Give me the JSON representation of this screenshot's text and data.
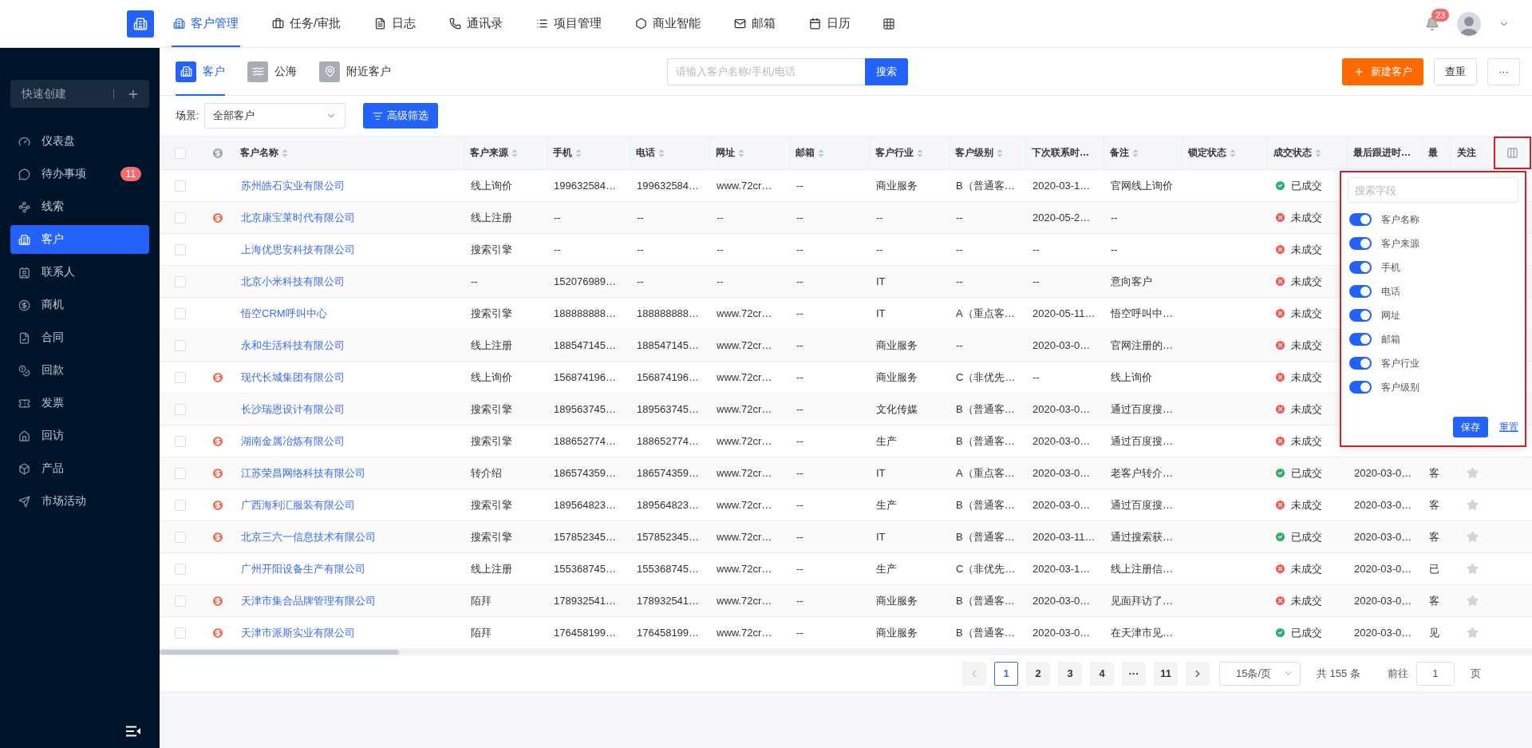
{
  "topbar": {
    "nav": [
      {
        "label": "客户管理",
        "selected": true
      },
      {
        "label": "任务/审批",
        "selected": false
      },
      {
        "label": "日志",
        "selected": false
      },
      {
        "label": "通讯录",
        "selected": false
      },
      {
        "label": "项目管理",
        "selected": false
      },
      {
        "label": "商业智能",
        "selected": false
      },
      {
        "label": "邮箱",
        "selected": false
      },
      {
        "label": "日历",
        "selected": false
      }
    ],
    "notifications": "23"
  },
  "sidebar": {
    "quick_create": "快速创建",
    "items": [
      {
        "label": "仪表盘",
        "selected": false
      },
      {
        "label": "待办事项",
        "selected": false,
        "badge": "11"
      },
      {
        "label": "线索",
        "selected": false
      },
      {
        "label": "客户",
        "selected": true
      },
      {
        "label": "联系人",
        "selected": false
      },
      {
        "label": "商机",
        "selected": false
      },
      {
        "label": "合同",
        "selected": false
      },
      {
        "label": "回款",
        "selected": false
      },
      {
        "label": "发票",
        "selected": false
      },
      {
        "label": "回访",
        "selected": false
      },
      {
        "label": "产品",
        "selected": false
      },
      {
        "label": "市场活动",
        "selected": false
      }
    ]
  },
  "subtabs": [
    {
      "label": "客户",
      "selected": true
    },
    {
      "label": "公海",
      "selected": false
    },
    {
      "label": "附近客户",
      "selected": false
    }
  ],
  "search": {
    "placeholder": "请输入客户名称/手机/电话",
    "button": "搜索"
  },
  "actions": {
    "create": "新建客户",
    "dedupe": "查重",
    "more": "···"
  },
  "filter": {
    "label": "场景:",
    "scene": "全部客户",
    "advanced": "高级筛选"
  },
  "table": {
    "header_checked": false,
    "columns": [
      {
        "label": "客户名称",
        "sortable": true
      },
      {
        "label": "客户来源",
        "sortable": true
      },
      {
        "label": "手机",
        "sortable": true
      },
      {
        "label": "电话",
        "sortable": true
      },
      {
        "label": "网址",
        "sortable": true
      },
      {
        "label": "邮箱",
        "sortable": true
      },
      {
        "label": "客户行业",
        "sortable": true
      },
      {
        "label": "客户级别",
        "sortable": true
      },
      {
        "label": "下次联系时…",
        "sortable": false
      },
      {
        "label": "备注",
        "sortable": true
      },
      {
        "label": "锁定状态",
        "sortable": true
      },
      {
        "label": "成交状态",
        "sortable": true
      },
      {
        "label": "最后跟进时…",
        "sortable": false
      },
      {
        "label": "最",
        "sortable": false
      },
      {
        "label": "关注",
        "sortable": false
      }
    ],
    "rows": [
      {
        "checked": false,
        "deal_icon": false,
        "name": "苏州皓石实业有限公司",
        "source": "线上询价",
        "mobile": "199632584…",
        "phone": "199632584…",
        "website": "www.72cr…",
        "email": "--",
        "industry": "商业服务",
        "level": "B（普通客…",
        "next_contact": "2020-03-1…",
        "note": "官网线上询价",
        "deal_status": "已成交",
        "closed": true
      },
      {
        "checked": false,
        "deal_icon": true,
        "name": "北京康宝莱时代有限公司",
        "source": "线上注册",
        "mobile": "--",
        "phone": "--",
        "website": "--",
        "email": "--",
        "industry": "--",
        "level": "--",
        "next_contact": "2020-05-2…",
        "note": "--",
        "deal_status": "未成交",
        "closed": false
      },
      {
        "checked": false,
        "deal_icon": false,
        "name": "上海优思安科技有限公司",
        "source": "搜索引擎",
        "mobile": "--",
        "phone": "--",
        "website": "--",
        "email": "--",
        "industry": "--",
        "level": "--",
        "next_contact": "--",
        "note": "--",
        "deal_status": "未成交",
        "closed": false
      },
      {
        "checked": false,
        "deal_icon": false,
        "name": "北京小米科技有限公司",
        "source": "--",
        "mobile": "152076989…",
        "phone": "--",
        "website": "--",
        "email": "--",
        "industry": "IT",
        "level": "--",
        "next_contact": "--",
        "note": "意向客户",
        "deal_status": "未成交",
        "closed": false
      },
      {
        "checked": false,
        "deal_icon": false,
        "name": "悟空CRM呼叫中心",
        "source": "搜索引擎",
        "mobile": "188888888…",
        "phone": "188888888…",
        "website": "www.72cr…",
        "email": "--",
        "industry": "IT",
        "level": "A（重点客…",
        "next_contact": "2020-05-11…",
        "note": "悟空呼叫中…",
        "deal_status": "未成交",
        "closed": false
      },
      {
        "checked": false,
        "deal_icon": false,
        "name": "永和生活科技有限公司",
        "source": "线上注册",
        "mobile": "188547145…",
        "phone": "188547145…",
        "website": "www.72cr…",
        "email": "--",
        "industry": "商业服务",
        "level": "--",
        "next_contact": "2020-03-0…",
        "note": "官网注册的…",
        "deal_status": "未成交",
        "closed": false
      },
      {
        "checked": false,
        "deal_icon": true,
        "name": "现代长城集团有限公司",
        "source": "线上询价",
        "mobile": "156874196…",
        "phone": "156874196…",
        "website": "www.72cr…",
        "email": "--",
        "industry": "商业服务",
        "level": "C（非优先…",
        "next_contact": "--",
        "note": "线上询价",
        "deal_status": "未成交",
        "closed": false
      },
      {
        "checked": false,
        "deal_icon": false,
        "name": "长沙瑞恩设计有限公司",
        "source": "搜索引擎",
        "mobile": "189563745…",
        "phone": "189563745…",
        "website": "www.72cr…",
        "email": "--",
        "industry": "文化传媒",
        "level": "B（普通客…",
        "next_contact": "2020-03-0…",
        "note": "通过百度搜…",
        "deal_status": "未成交",
        "closed": false
      },
      {
        "checked": false,
        "deal_icon": true,
        "name": "湖南金属冶炼有限公司",
        "source": "搜索引擎",
        "mobile": "188652774…",
        "phone": "188652774…",
        "website": "www.72cr…",
        "email": "--",
        "industry": "生产",
        "level": "B（普通客…",
        "next_contact": "2020-03-0…",
        "note": "通过百度搜…",
        "deal_status": "未成交",
        "closed": false
      },
      {
        "checked": false,
        "deal_icon": true,
        "name": "江苏荣昌网络科技有限公司",
        "source": "转介绍",
        "mobile": "186574359…",
        "phone": "186574359…",
        "website": "www.72cr…",
        "email": "--",
        "industry": "IT",
        "level": "A（重点客…",
        "next_contact": "2020-03-0…",
        "note": "老客户转介…",
        "deal_status": "已成交",
        "closed": true,
        "last_follow": "2020-03-0…",
        "last": "客",
        "followed": false
      },
      {
        "checked": false,
        "deal_icon": true,
        "name": "广西海利汇服装有限公司",
        "source": "搜索引擎",
        "mobile": "189564823…",
        "phone": "189564823…",
        "website": "www.72cr…",
        "email": "--",
        "industry": "生产",
        "level": "B（普通客…",
        "next_contact": "2020-03-0…",
        "note": "通过百度搜…",
        "deal_status": "未成交",
        "closed": false,
        "last_follow": "2020-03-0…",
        "last": "客",
        "followed": false
      },
      {
        "checked": false,
        "deal_icon": true,
        "name": "北京三六一信息技术有限公司",
        "source": "搜索引擎",
        "mobile": "157852345…",
        "phone": "157852345…",
        "website": "www.72cr…",
        "email": "--",
        "industry": "IT",
        "level": "B（普通客…",
        "next_contact": "2020-03-11…",
        "note": "通过搜索获…",
        "deal_status": "已成交",
        "closed": true,
        "last_follow": "2020-03-0…",
        "last": "客",
        "followed": false
      },
      {
        "checked": false,
        "deal_icon": false,
        "name": "广州开阳设备生产有限公司",
        "source": "线上注册",
        "mobile": "155368745…",
        "phone": "155368745…",
        "website": "www.72cr…",
        "email": "--",
        "industry": "生产",
        "level": "C（非优先…",
        "next_contact": "2020-03-1…",
        "note": "线上注册信…",
        "deal_status": "未成交",
        "closed": false,
        "last_follow": "2020-03-0…",
        "last": "已",
        "followed": false
      },
      {
        "checked": false,
        "deal_icon": true,
        "name": "天津市集合品牌管理有限公司",
        "source": "陌拜",
        "mobile": "178932541…",
        "phone": "178932541…",
        "website": "www.72cr…",
        "email": "--",
        "industry": "商业服务",
        "level": "B（普通客…",
        "next_contact": "2020-03-0…",
        "note": "见面拜访了…",
        "deal_status": "未成交",
        "closed": false,
        "last_follow": "2020-03-0…",
        "last": "客",
        "followed": false
      },
      {
        "checked": false,
        "deal_icon": true,
        "name": "天津市派斯实业有限公司",
        "source": "陌拜",
        "mobile": "176458199…",
        "phone": "176458199…",
        "website": "www.72cr…",
        "email": "--",
        "industry": "商业服务",
        "level": "B（普通客…",
        "next_contact": "2020-03-0…",
        "note": "在天津市见…",
        "deal_status": "已成交",
        "closed": true,
        "last_follow": "2020-03-0…",
        "last": "见",
        "followed": false
      }
    ]
  },
  "column_picker": {
    "placeholder": "搜索字段",
    "fields": [
      {
        "label": "客户名称",
        "on": true
      },
      {
        "label": "客户来源",
        "on": true
      },
      {
        "label": "手机",
        "on": true
      },
      {
        "label": "电话",
        "on": true
      },
      {
        "label": "网址",
        "on": true
      },
      {
        "label": "邮箱",
        "on": true
      },
      {
        "label": "客户行业",
        "on": true
      },
      {
        "label": "客户级别",
        "on": true
      }
    ],
    "save": "保存",
    "reset": "重置"
  },
  "pagination": {
    "pages": [
      {
        "label": "1",
        "selected": true
      },
      {
        "label": "2",
        "selected": false
      },
      {
        "label": "3",
        "selected": false
      },
      {
        "label": "4",
        "selected": false
      },
      {
        "label": "···",
        "selected": false
      },
      {
        "label": "11",
        "selected": false
      }
    ],
    "page_size": "15条/页",
    "total": "共 155 条",
    "goto_label": "前往",
    "goto_value": "1",
    "goto_suffix": "页"
  }
}
